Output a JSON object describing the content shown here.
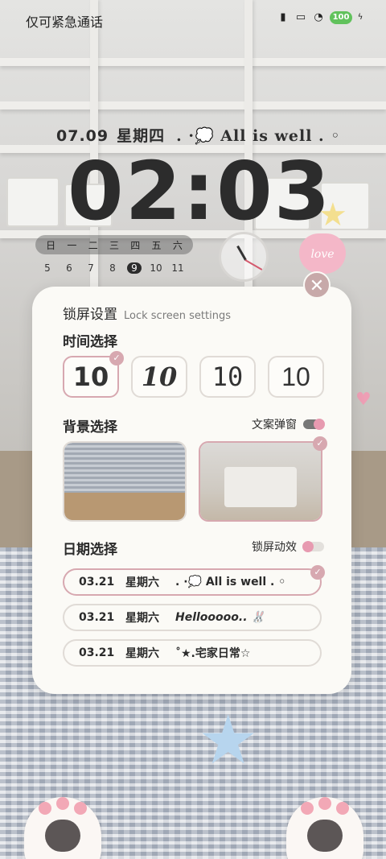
{
  "status_bar": {
    "emergency_text": "仅可紧急通话",
    "battery": "100"
  },
  "clock": {
    "date": "07.09",
    "weekday": "星期四",
    "mood": ". ·💭 All is well . ◦",
    "time": "02:03",
    "calendar_weekdays": [
      "日",
      "一",
      "二",
      "三",
      "四",
      "五",
      "六"
    ],
    "calendar_days": [
      "5",
      "6",
      "7",
      "8",
      "9",
      "10",
      "11"
    ],
    "today": "9"
  },
  "stickers": {
    "love": "love"
  },
  "settings": {
    "title": "锁屏设置",
    "title_en": "Lock screen settings",
    "time_section": "时间选择",
    "time_options": [
      "10",
      "10",
      "10",
      "10"
    ],
    "time_selected_index": 0,
    "bg_section": "背景选择",
    "bg_toggle_label": "文案弹窗",
    "bg_toggle_on": true,
    "bg_selected_index": 1,
    "date_section": "日期选择",
    "date_toggle_label": "锁屏动效",
    "date_toggle_on": false,
    "date_options": [
      {
        "date": "03.21",
        "weekday": "星期六",
        "text": ". ·💭 All is well . ◦"
      },
      {
        "date": "03.21",
        "weekday": "星期六",
        "text": "Hellooooo.. 🐰"
      },
      {
        "date": "03.21",
        "weekday": "星期六",
        "text": "˚★.宅家日常☆"
      }
    ],
    "date_selected_index": 0
  },
  "colors": {
    "accent": "#d7a8b0",
    "card_bg": "#fbfaf6",
    "toggle_knob": "#e79ab0"
  }
}
